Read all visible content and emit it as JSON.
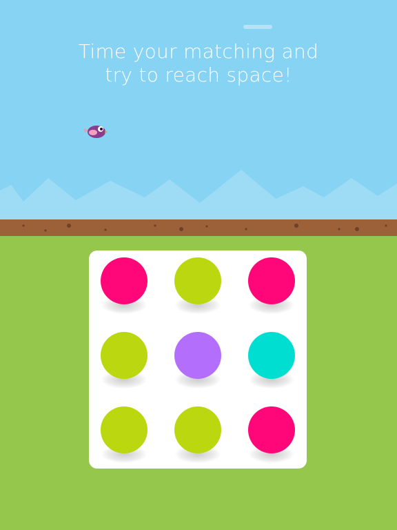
{
  "hint": {
    "line1": "Time your matching and",
    "line2": "try to reach space!"
  },
  "colors": {
    "sky": "#86d3f4",
    "hills": "#9edcf5",
    "dirt": "#9c6138",
    "dirt_specks": "#6e4127",
    "grass": "#94c74c",
    "board": "#ffffff"
  },
  "character": {
    "icon": "purple-bird-icon",
    "body_color": "#8a3c8e",
    "wing_color": "#f0a0b8"
  },
  "grid": {
    "rows": 3,
    "cols": 3,
    "dots": [
      {
        "color_name": "pink",
        "color": "#ff0679"
      },
      {
        "color_name": "lime",
        "color": "#bbd70f"
      },
      {
        "color_name": "pink",
        "color": "#ff0679"
      },
      {
        "color_name": "lime",
        "color": "#bbd70f"
      },
      {
        "color_name": "purple",
        "color": "#b36ffb"
      },
      {
        "color_name": "cyan",
        "color": "#00ddd1"
      },
      {
        "color_name": "lime",
        "color": "#bbd70f"
      },
      {
        "color_name": "lime",
        "color": "#bbd70f"
      },
      {
        "color_name": "pink",
        "color": "#ff0679"
      }
    ]
  }
}
